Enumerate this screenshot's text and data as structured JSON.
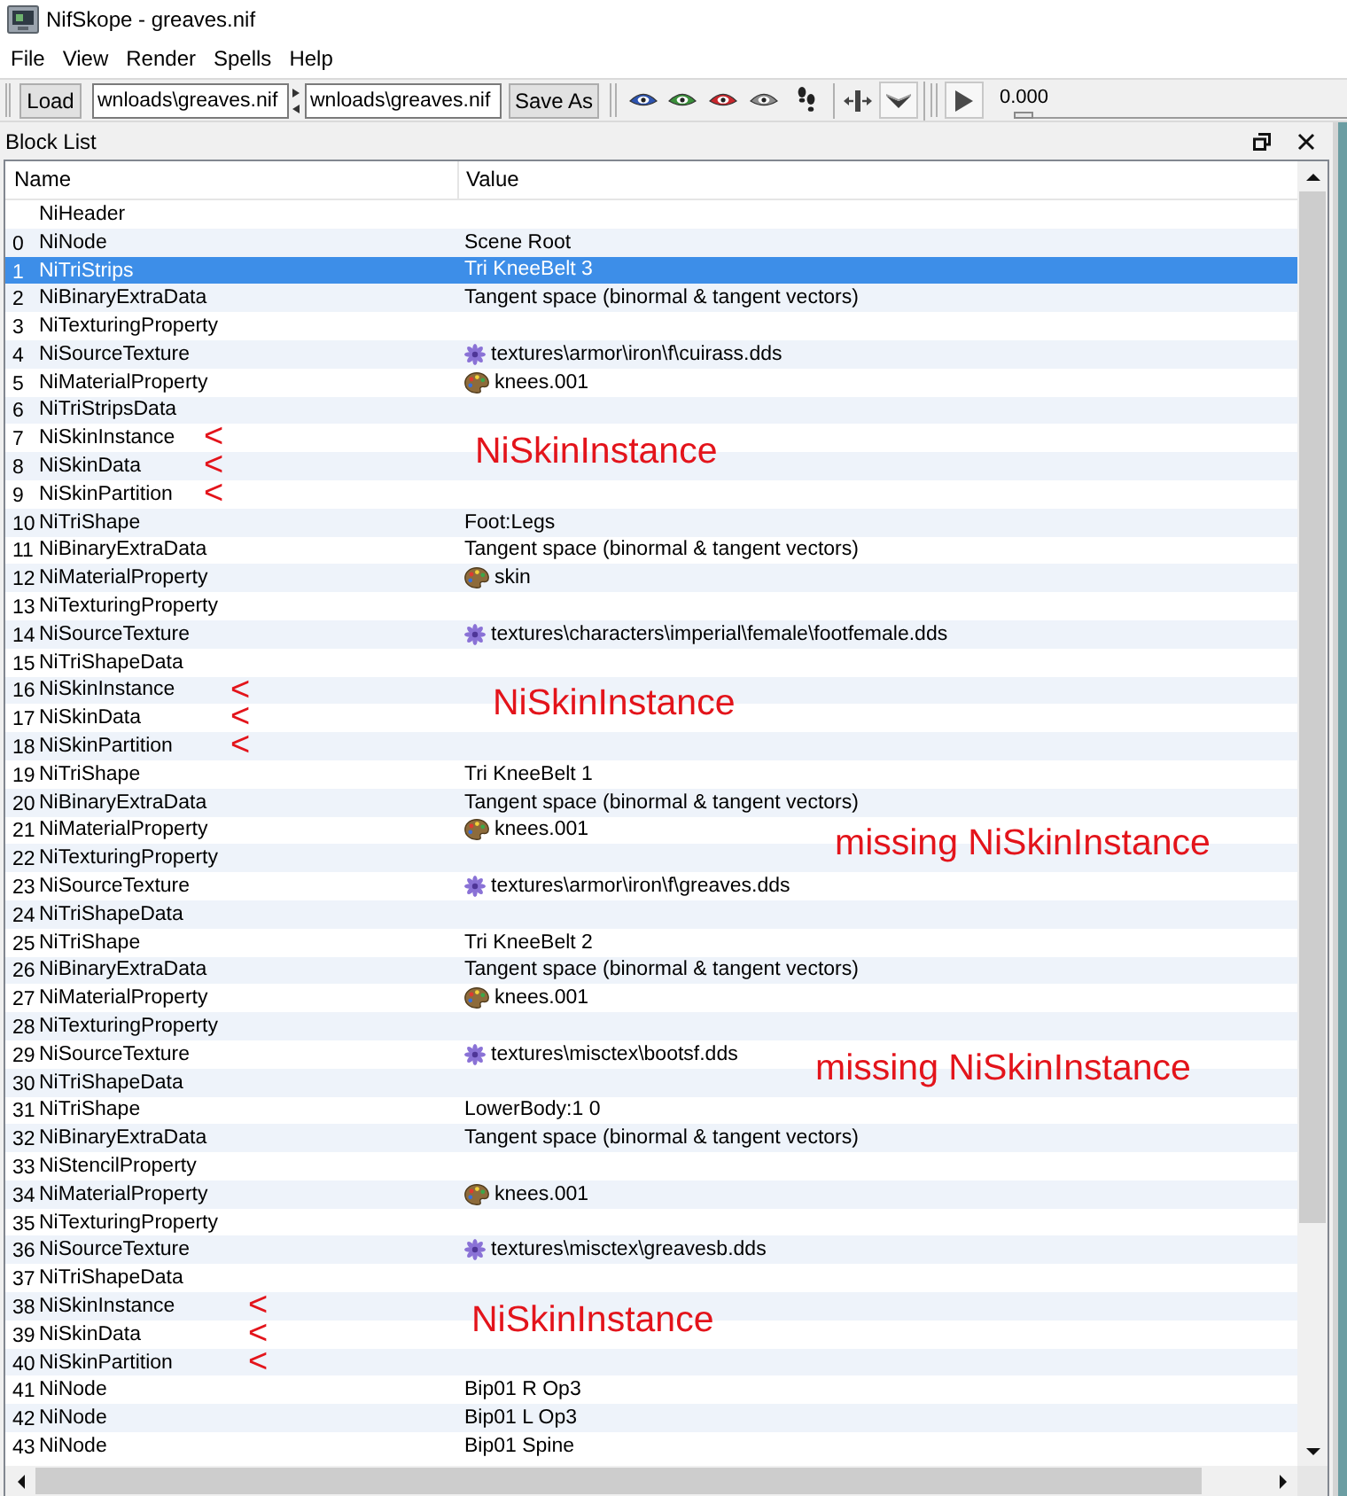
{
  "window": {
    "title": "NifSkope - greaves.nif"
  },
  "menu": [
    "File",
    "View",
    "Render",
    "Spells",
    "Help"
  ],
  "toolbar": {
    "load_button": "Load",
    "input_path": "wnloads\\greaves.nif",
    "output_path": "wnloads\\greaves.nif",
    "save_button": "Save As",
    "time": "0.000",
    "time_slider": {
      "level": 0
    }
  },
  "block_list": {
    "title": "Block List",
    "columns": [
      "Name",
      "Value"
    ],
    "rows": [
      {
        "name": "NiHeader",
        "kind": "plain",
        "selected": false
      },
      {
        "index": "0",
        "name": "NiNode",
        "value": "Scene Root",
        "kind": "plain",
        "selected": false
      },
      {
        "index": "1",
        "name": "NiTriStrips",
        "value": "Tri KneeBelt 3",
        "kind": "plain",
        "selected": true
      },
      {
        "index": "2",
        "name": "NiBinaryExtraData",
        "value": "Tangent space (binormal & tangent vectors)",
        "kind": "plain",
        "selected": false
      },
      {
        "index": "3",
        "name": "NiTexturingProperty",
        "kind": "plain",
        "selected": false
      },
      {
        "index": "4",
        "name": "NiSourceTexture",
        "value": "textures\\armor\\iron\\f\\cuirass.dds",
        "kind": "texture",
        "selected": false
      },
      {
        "index": "5",
        "name": "NiMaterialProperty",
        "value": "knees.001",
        "kind": "material",
        "selected": false
      },
      {
        "index": "6",
        "name": "NiTriStripsData",
        "kind": "plain",
        "selected": false
      },
      {
        "index": "7",
        "name": "NiSkinInstance",
        "kind": "plain",
        "selected": false,
        "note": "<"
      },
      {
        "index": "8",
        "name": "NiSkinData",
        "kind": "plain",
        "selected": false,
        "note": "<",
        "callout": "NiSkinInstance"
      },
      {
        "index": "9",
        "name": "NiSkinPartition",
        "kind": "plain",
        "selected": false,
        "note": "<"
      },
      {
        "index": "10",
        "name": "NiTriShape",
        "value": "Foot:Legs",
        "kind": "plain",
        "selected": false
      },
      {
        "index": "11",
        "name": "NiBinaryExtraData",
        "value": "Tangent space (binormal & tangent vectors)",
        "kind": "plain",
        "selected": false
      },
      {
        "index": "12",
        "name": "NiMaterialProperty",
        "value": "skin",
        "kind": "material",
        "selected": false
      },
      {
        "index": "13",
        "name": "NiTexturingProperty",
        "kind": "plain",
        "selected": false
      },
      {
        "index": "14",
        "name": "NiSourceTexture",
        "value": "textures\\characters\\imperial\\female\\footfemale.dds",
        "kind": "texture",
        "selected": false
      },
      {
        "index": "15",
        "name": "NiTriShapeData",
        "kind": "plain",
        "selected": false
      },
      {
        "index": "16",
        "name": "NiSkinInstance",
        "kind": "plain",
        "selected": false,
        "note": "<"
      },
      {
        "index": "17",
        "name": "NiSkinData",
        "kind": "plain",
        "selected": false,
        "note": "<",
        "callout": "NiSkinInstance"
      },
      {
        "index": "18",
        "name": "NiSkinPartition",
        "kind": "plain",
        "selected": false,
        "note": "<"
      },
      {
        "index": "19",
        "name": "NiTriShape",
        "value": "Tri KneeBelt 1",
        "kind": "plain",
        "selected": false
      },
      {
        "index": "20",
        "name": "NiBinaryExtraData",
        "value": "Tangent space (binormal & tangent vectors)",
        "kind": "plain",
        "selected": false
      },
      {
        "index": "21",
        "name": "NiMaterialProperty",
        "value": "knees.001",
        "kind": "material",
        "selected": false
      },
      {
        "index": "22",
        "name": "NiTexturingProperty",
        "kind": "plain",
        "selected": false,
        "callout": "missing NiSkinInstance"
      },
      {
        "index": "23",
        "name": "NiSourceTexture",
        "value": "textures\\armor\\iron\\f\\greaves.dds",
        "kind": "texture",
        "selected": false
      },
      {
        "index": "24",
        "name": "NiTriShapeData",
        "kind": "plain",
        "selected": false
      },
      {
        "index": "25",
        "name": "NiTriShape",
        "value": "Tri KneeBelt 2",
        "kind": "plain",
        "selected": false
      },
      {
        "index": "26",
        "name": "NiBinaryExtraData",
        "value": "Tangent space (binormal & tangent vectors)",
        "kind": "plain",
        "selected": false
      },
      {
        "index": "27",
        "name": "NiMaterialProperty",
        "value": "knees.001",
        "kind": "material",
        "selected": false
      },
      {
        "index": "28",
        "name": "NiTexturingProperty",
        "kind": "plain",
        "selected": false
      },
      {
        "index": "29",
        "name": "NiSourceTexture",
        "value": "textures\\misctex\\bootsf.dds",
        "kind": "texture",
        "selected": false
      },
      {
        "index": "30",
        "name": "NiTriShapeData",
        "kind": "plain",
        "selected": false,
        "callout": "missing NiSkinInstance"
      },
      {
        "index": "31",
        "name": "NiTriShape",
        "value": "LowerBody:1 0",
        "kind": "plain",
        "selected": false
      },
      {
        "index": "32",
        "name": "NiBinaryExtraData",
        "value": "Tangent space (binormal & tangent vectors)",
        "kind": "plain",
        "selected": false
      },
      {
        "index": "33",
        "name": "NiStencilProperty",
        "kind": "plain",
        "selected": false
      },
      {
        "index": "34",
        "name": "NiMaterialProperty",
        "value": "knees.001",
        "kind": "material",
        "selected": false
      },
      {
        "index": "35",
        "name": "NiTexturingProperty",
        "kind": "plain",
        "selected": false
      },
      {
        "index": "36",
        "name": "NiSourceTexture",
        "value": "textures\\misctex\\greavesb.dds",
        "kind": "texture",
        "selected": false
      },
      {
        "index": "37",
        "name": "NiTriShapeData",
        "kind": "plain",
        "selected": false
      },
      {
        "index": "38",
        "name": "NiSkinInstance",
        "kind": "plain",
        "selected": false,
        "note": "<"
      },
      {
        "index": "39",
        "name": "NiSkinData",
        "kind": "plain",
        "selected": false,
        "note": "<",
        "callout": "NiSkinInstance"
      },
      {
        "index": "40",
        "name": "NiSkinPartition",
        "kind": "plain",
        "selected": false,
        "note": "<"
      },
      {
        "index": "41",
        "name": "NiNode",
        "value": "Bip01 R Op3",
        "kind": "plain",
        "selected": false
      },
      {
        "index": "42",
        "name": "NiNode",
        "value": "Bip01 L Op3",
        "kind": "plain",
        "selected": false
      },
      {
        "index": "43",
        "name": "NiNode",
        "value": "Bip01 Spine",
        "kind": "plain",
        "selected": false
      }
    ]
  }
}
